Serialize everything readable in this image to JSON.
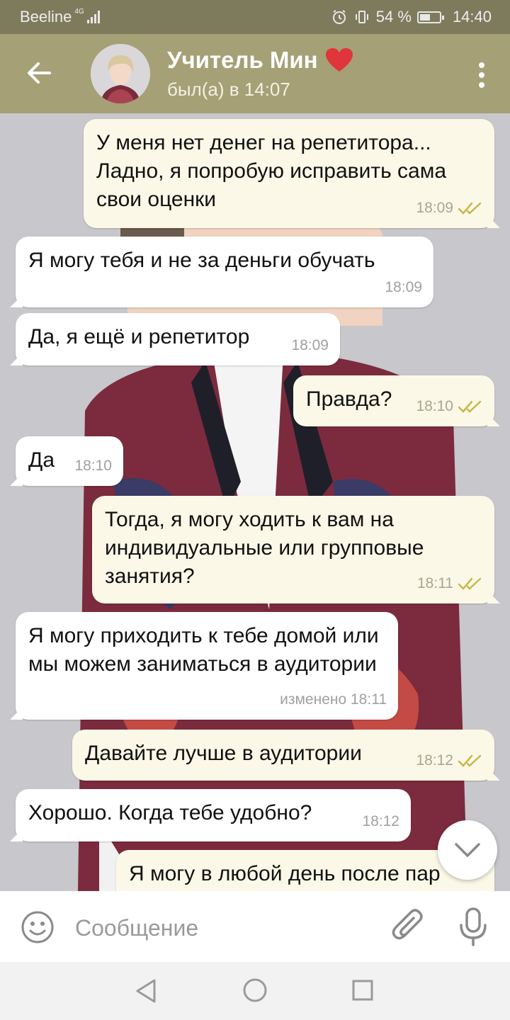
{
  "status_bar": {
    "carrier": "Beeline",
    "network": "4G",
    "battery": "54 %",
    "time": "14:40"
  },
  "header": {
    "title": "Учитель Мин",
    "last_seen": "был(а) в 14:07",
    "title_emoji": "red-heart-icon"
  },
  "messages": [
    {
      "direction": "out",
      "text": "У меня нет денег на репетитора... Ладно, я попробую исправить сама свои оценки",
      "time": "18:09",
      "read": true
    },
    {
      "direction": "in",
      "text": "Я могу тебя и не за деньги обучать",
      "time": "18:09"
    },
    {
      "direction": "in",
      "text": "Да, я ещё и репетитор",
      "time": "18:09"
    },
    {
      "direction": "out",
      "text": "Правда?",
      "time": "18:10",
      "read": true
    },
    {
      "direction": "in",
      "text": "Да",
      "time": "18:10"
    },
    {
      "direction": "out",
      "text": "Тогда, я могу ходить к вам на индивидуальные или групповые занятия?",
      "time": "18:11",
      "read": true
    },
    {
      "direction": "in",
      "text": "Я могу приходить к тебе домой или мы можем заниматься в аудитории",
      "time": "изменено 18:11"
    },
    {
      "direction": "out",
      "text": "Давайте лучше в аудитории",
      "time": "18:12",
      "read": true
    },
    {
      "direction": "in",
      "text": "Хорошо. Когда тебе удобно?",
      "time": "18:12"
    },
    {
      "direction": "out",
      "text": "Я могу в любой день после пар",
      "time": "",
      "read": false
    }
  ],
  "input": {
    "placeholder": "Сообщение"
  },
  "colors": {
    "status_bar": "#7e7b5d",
    "header": "#a5a076",
    "incoming_bubble": "#ffffff",
    "outgoing_bubble": "#fcf8e8",
    "read_checks": "#c8b84a"
  }
}
